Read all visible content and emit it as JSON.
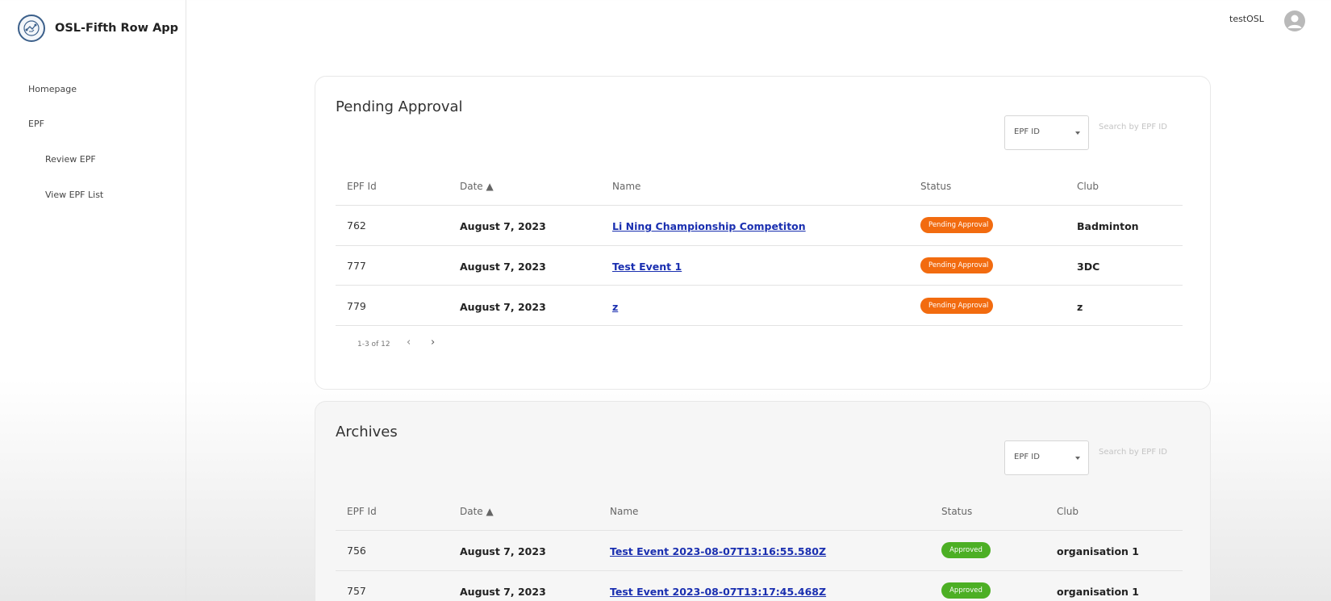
{
  "app": {
    "title": "OSL-Fifth Row App",
    "logo_icon": "circuit-logo-icon"
  },
  "sidebar": {
    "items": [
      {
        "label": "Homepage"
      },
      {
        "label": "EPF"
      },
      {
        "label": "Review EPF"
      },
      {
        "label": "View EPF List"
      }
    ]
  },
  "user": {
    "name": "testOSL",
    "avatar_icon": "user-avatar-icon"
  },
  "pending": {
    "title": "Pending Approval",
    "filter_value": "EPF ID",
    "search_placeholder": "Search by EPF ID",
    "columns": [
      "EPF Id",
      "Date ▲",
      "Name",
      "Status",
      "Club"
    ],
    "rows": [
      {
        "id": "762",
        "date": "August 7, 2023",
        "name": "Li Ning Championship Competiton",
        "status": "Pending Approval",
        "club": "Badminton"
      },
      {
        "id": "777",
        "date": "August 7, 2023",
        "name": "Test Event 1",
        "status": "Pending Approval",
        "club": "3DC"
      },
      {
        "id": "779",
        "date": "August 7, 2023",
        "name": "z",
        "status": "Pending Approval",
        "club": "z"
      }
    ],
    "pagination": {
      "text": "1-3 of 12",
      "prev": "‹",
      "next": "›"
    }
  },
  "archives": {
    "title": "Archives",
    "filter_value": "EPF ID",
    "search_placeholder": "Search by EPF ID",
    "columns": [
      "EPF Id",
      "Date ▲",
      "Name",
      "Status",
      "Club"
    ],
    "rows": [
      {
        "id": "756",
        "date": "August 7, 2023",
        "name": "Test Event 2023-08-07T13:16:55.580Z",
        "status": "Approved",
        "club": "organisation 1"
      },
      {
        "id": "757",
        "date": "August 7, 2023",
        "name": "Test Event 2023-08-07T13:17:45.468Z",
        "status": "Approved",
        "club": "organisation 1"
      }
    ]
  },
  "colors": {
    "pending": "#f26b0f",
    "approved": "#4caf24",
    "link": "#1a2fb0"
  }
}
